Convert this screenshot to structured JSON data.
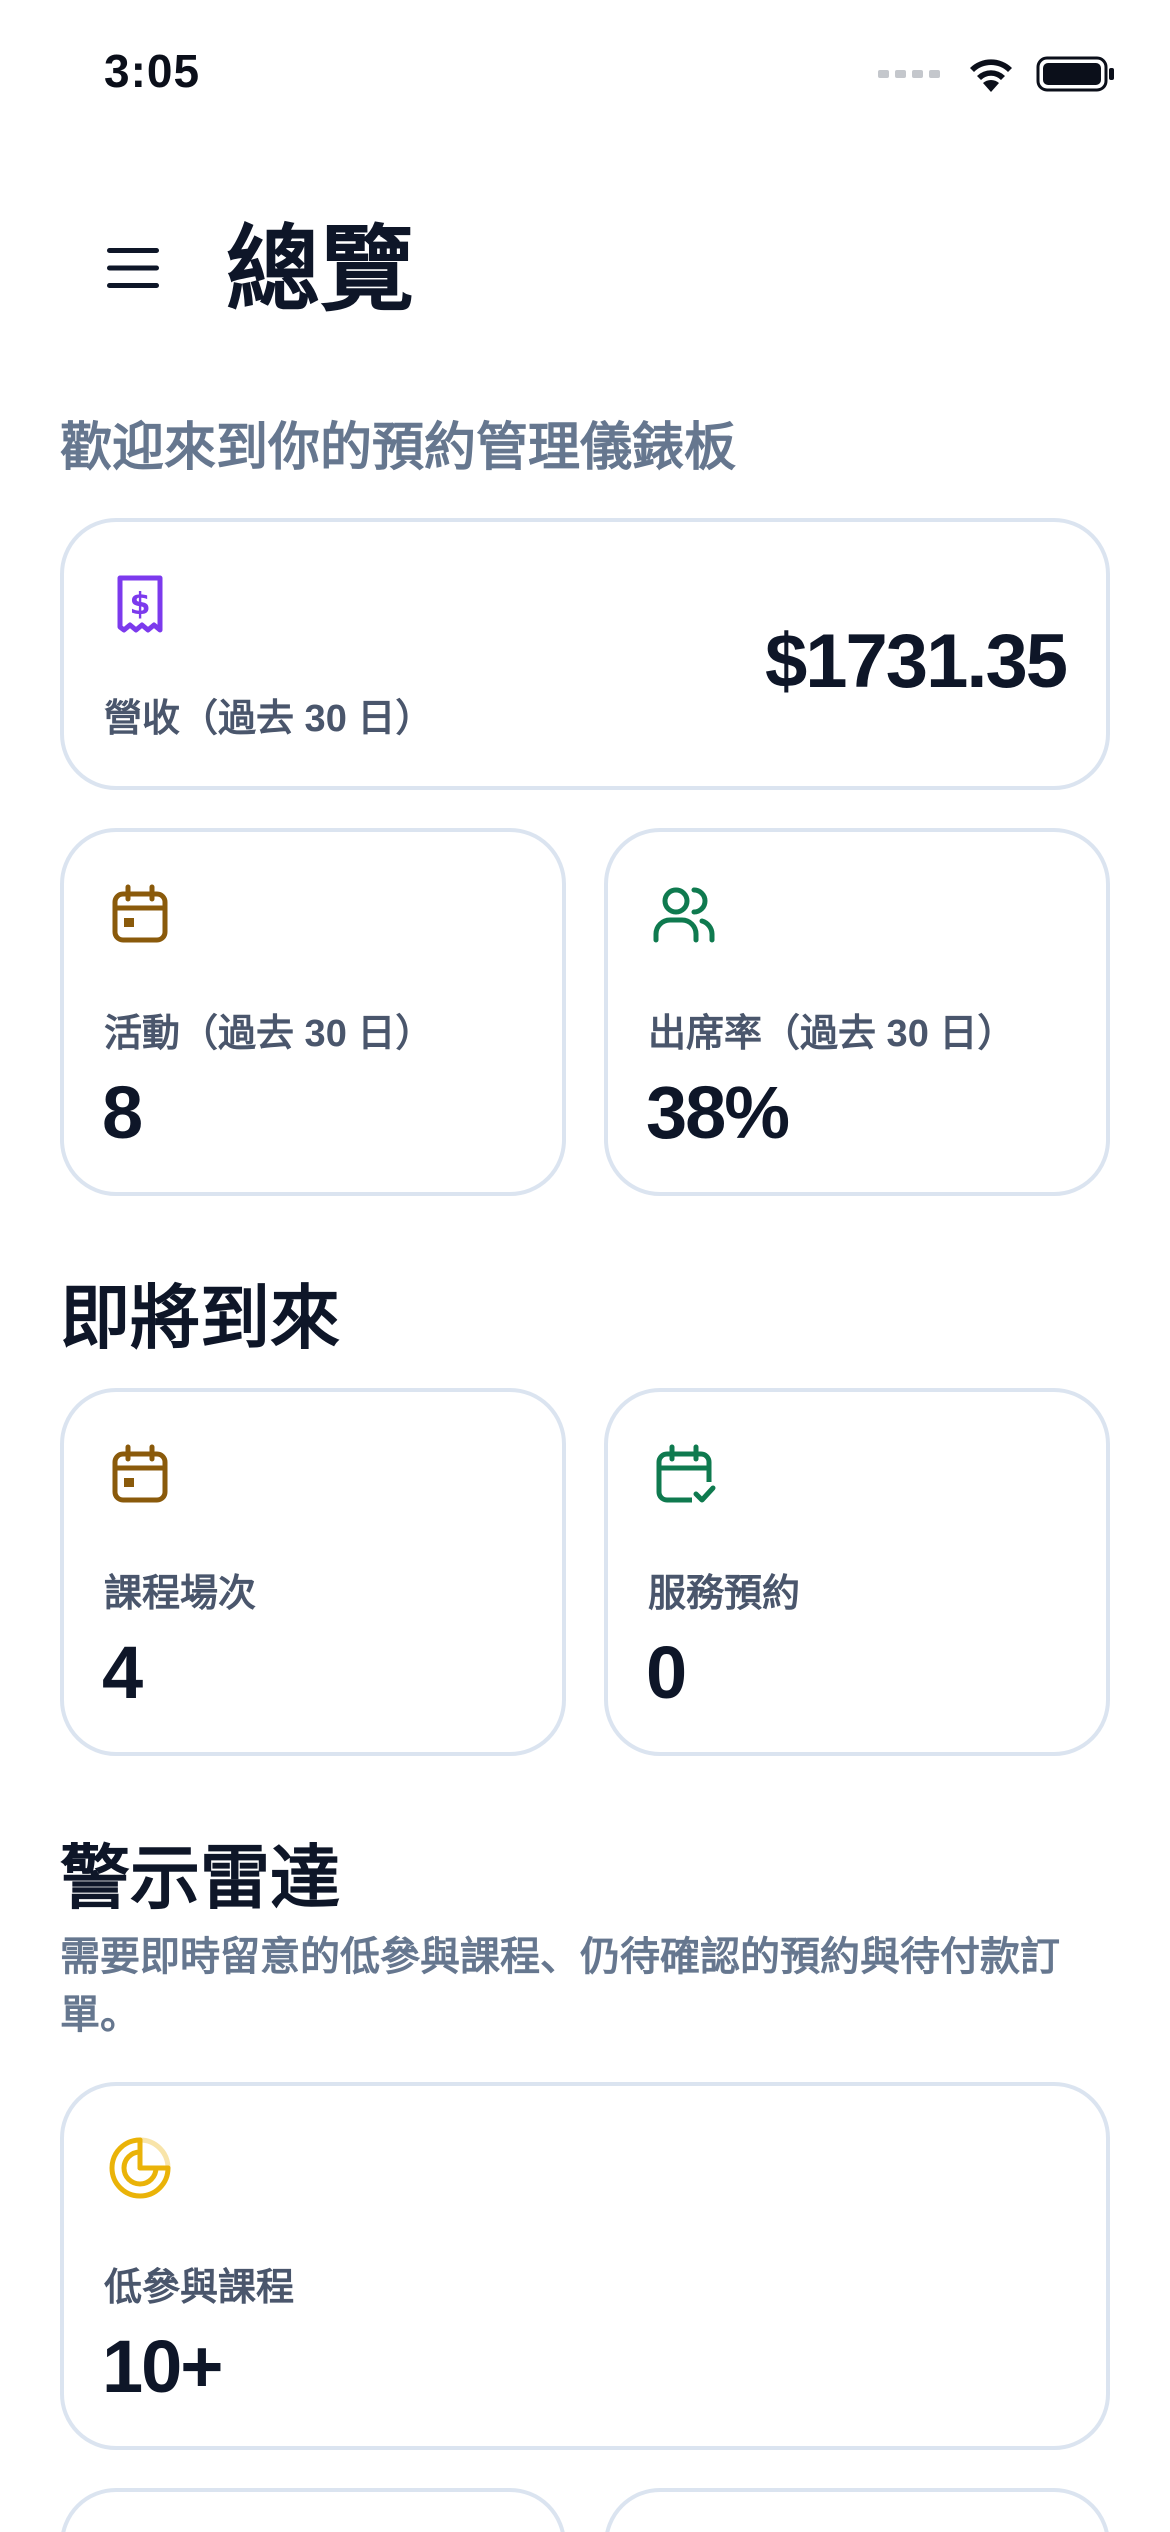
{
  "status_bar": {
    "time": "3:05"
  },
  "header": {
    "title": "總覽"
  },
  "subtitle": "歡迎來到你的預約管理儀錶板",
  "stats": {
    "revenue": {
      "label": "營收（過去 30 日）",
      "value": "$1731.35",
      "icon": "receipt-dollar-icon",
      "color": "#7c3aed"
    },
    "events": {
      "label": "活動（過去 30 日）",
      "value": "8",
      "icon": "calendar-icon",
      "color": "#8a5a0b"
    },
    "attendance": {
      "label": "出席率（過去 30 日）",
      "value": "38%",
      "icon": "users-icon",
      "color": "#0f7a4f"
    }
  },
  "upcoming": {
    "title": "即將到來",
    "class_sessions": {
      "label": "課程場次",
      "value": "4",
      "icon": "calendar-icon",
      "color": "#8a5a0b"
    },
    "service_bookings": {
      "label": "服務預約",
      "value": "0",
      "icon": "calendar-check-icon",
      "color": "#0f7a4f"
    }
  },
  "alerts": {
    "title": "警示雷達",
    "description": "需要即時留意的低參與課程、仍待確認的預約與待付款訂單。",
    "low_engagement": {
      "label": "低參與課程",
      "value": "10+",
      "icon": "radar-icon",
      "color": "#eab308"
    }
  }
}
